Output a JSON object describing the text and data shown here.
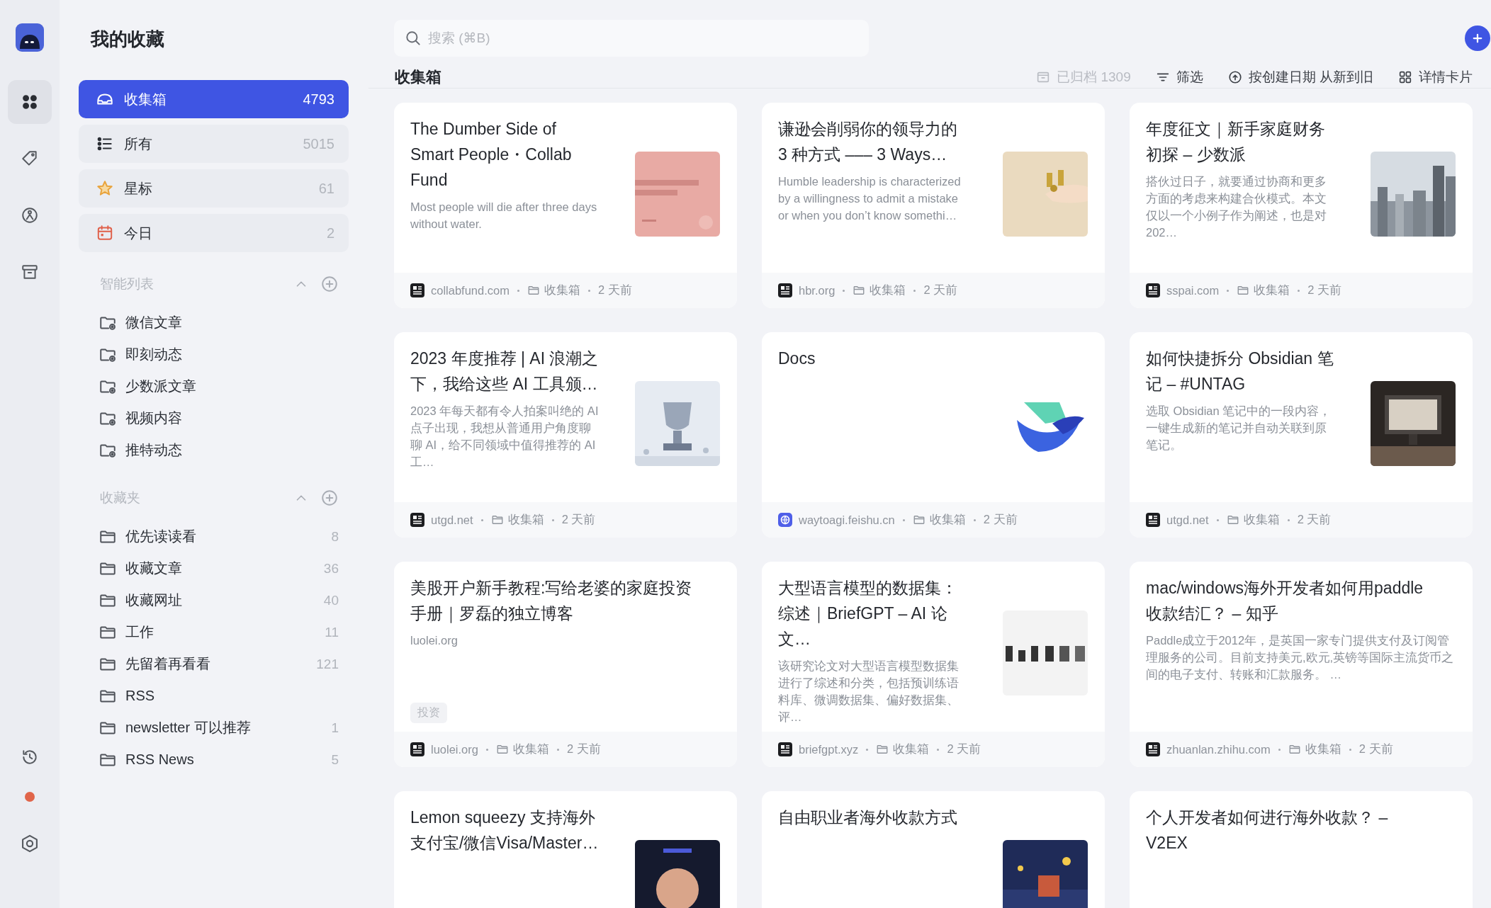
{
  "rail": {
    "items": [
      {
        "selected": true
      },
      {
        "selected": false
      },
      {
        "selected": false
      },
      {
        "selected": false
      }
    ],
    "status": {
      "color": "#e0654a"
    }
  },
  "sidebar": {
    "title": "我的收藏",
    "nav": [
      {
        "label": "收集箱",
        "count": "4793",
        "selected": true
      },
      {
        "label": "所有",
        "count": "5015",
        "selected": false
      },
      {
        "label": "星标",
        "count": "61",
        "selected": false
      },
      {
        "label": "今日",
        "count": "2",
        "selected": false
      }
    ],
    "smart_lists": {
      "title": "智能列表",
      "expanded": true,
      "items": [
        {
          "label": "微信文章"
        },
        {
          "label": "即刻动态"
        },
        {
          "label": "少数派文章"
        },
        {
          "label": "视频内容"
        },
        {
          "label": "推特动态"
        }
      ]
    },
    "folders": {
      "title": "收藏夹",
      "expanded": true,
      "items": [
        {
          "label": "优先读读看",
          "count": "8"
        },
        {
          "label": "收藏文章",
          "count": "36"
        },
        {
          "label": "收藏网址",
          "count": "40"
        },
        {
          "label": "工作",
          "count": "11"
        },
        {
          "label": "先留着再看看",
          "count": "121"
        },
        {
          "label": "RSS"
        },
        {
          "label": "newsletter 可以推荐",
          "count": "1"
        },
        {
          "label": "RSS News",
          "count": "5"
        }
      ]
    }
  },
  "search": {
    "placeholder": "搜索 (⌘B)"
  },
  "header": {
    "title": "收集箱",
    "toolbar": [
      {
        "label": "已归档 1309",
        "disabled": true
      },
      {
        "label": "筛选",
        "disabled": false
      },
      {
        "label": "按创建日期 从新到旧",
        "disabled": false
      },
      {
        "label": "详情卡片",
        "disabled": false
      }
    ]
  },
  "cards": [
    {
      "title": "The Dumber Side of Smart People・Collab Fund",
      "description": "Most people will die after three days without water.",
      "source": {
        "kind": "article",
        "domain": "collabfund.com",
        "folder": "收集箱",
        "time": "2 天前"
      }
    },
    {
      "title": "谦逊会削弱你的领导力的 3 种方式 ––– 3 Ways…",
      "description": "Humble leadership is characterized by a willingness to admit a mistake or when you don’t know somethi…",
      "source": {
        "kind": "article",
        "domain": "hbr.org",
        "folder": "收集箱",
        "time": "2 天前"
      }
    },
    {
      "title": "年度征文｜新手家庭财务初探 – 少数派",
      "description": "搭伙过日子，就要通过协商和更多方面的考虑来构建合伙模式。本文仅以一个小例子作为阐述，也是对 202…",
      "source": {
        "kind": "article",
        "domain": "sspai.com",
        "folder": "收集箱",
        "time": "2 天前"
      }
    },
    {
      "title": "2023 年度推荐 | AI 浪潮之下，我给这些 AI 工具颁…",
      "description": "2023 年每天都有令人拍案叫绝的 AI 点子出现，我想从普通用户角度聊聊 AI，给不同领域中值得推荐的 AI 工…",
      "source": {
        "kind": "article",
        "domain": "utgd.net",
        "folder": "收集箱",
        "time": "2 天前"
      }
    },
    {
      "title": "Docs",
      "source": {
        "kind": "globe",
        "domain": "waytoagi.feishu.cn",
        "folder": "收集箱",
        "time": "2 天前"
      }
    },
    {
      "title": "如何快捷拆分 Obsidian 笔记 – #UNTAG",
      "description": "选取 Obsidian 笔记中的一段内容，一键生成新的笔记并自动关联到原笔记。",
      "source": {
        "kind": "article",
        "domain": "utgd.net",
        "folder": "收集箱",
        "time": "2 天前"
      }
    },
    {
      "title": "美股开户新手教程:写给老婆的家庭投资手册｜罗磊的独立博客",
      "description": "luolei.org",
      "tags": [
        "投资"
      ],
      "source": {
        "kind": "article",
        "domain": "luolei.org",
        "folder": "收集箱",
        "time": "2 天前"
      }
    },
    {
      "title": "大型语言模型的数据集：综述｜BriefGPT – AI 论文…",
      "description": "该研究论文对大型语言模型数据集进行了综述和分类，包括预训练语料库、微调数据集、偏好数据集、评…",
      "source": {
        "kind": "article",
        "domain": "briefgpt.xyz",
        "folder": "收集箱",
        "time": "2 天前"
      }
    },
    {
      "title": "mac/windows海外开发者如何用paddle收款结汇？ – 知乎",
      "description": "Paddle成立于2012年，是英国一家专门提供支付及订阅管理服务的公司。目前支持美元,欧元,英镑等国际主流货币之间的电子支付、转账和汇款服务。 …",
      "source": {
        "kind": "article",
        "domain": "zhuanlan.zhihu.com",
        "folder": "收集箱",
        "time": "2 天前"
      }
    },
    {
      "title": "Lemon squeezy 支持海外支付宝/微信Visa/Master…"
    },
    {
      "title": "自由职业者海外收款方式"
    },
    {
      "title": "个人开发者如何进行海外收款？ – V2EX"
    }
  ]
}
